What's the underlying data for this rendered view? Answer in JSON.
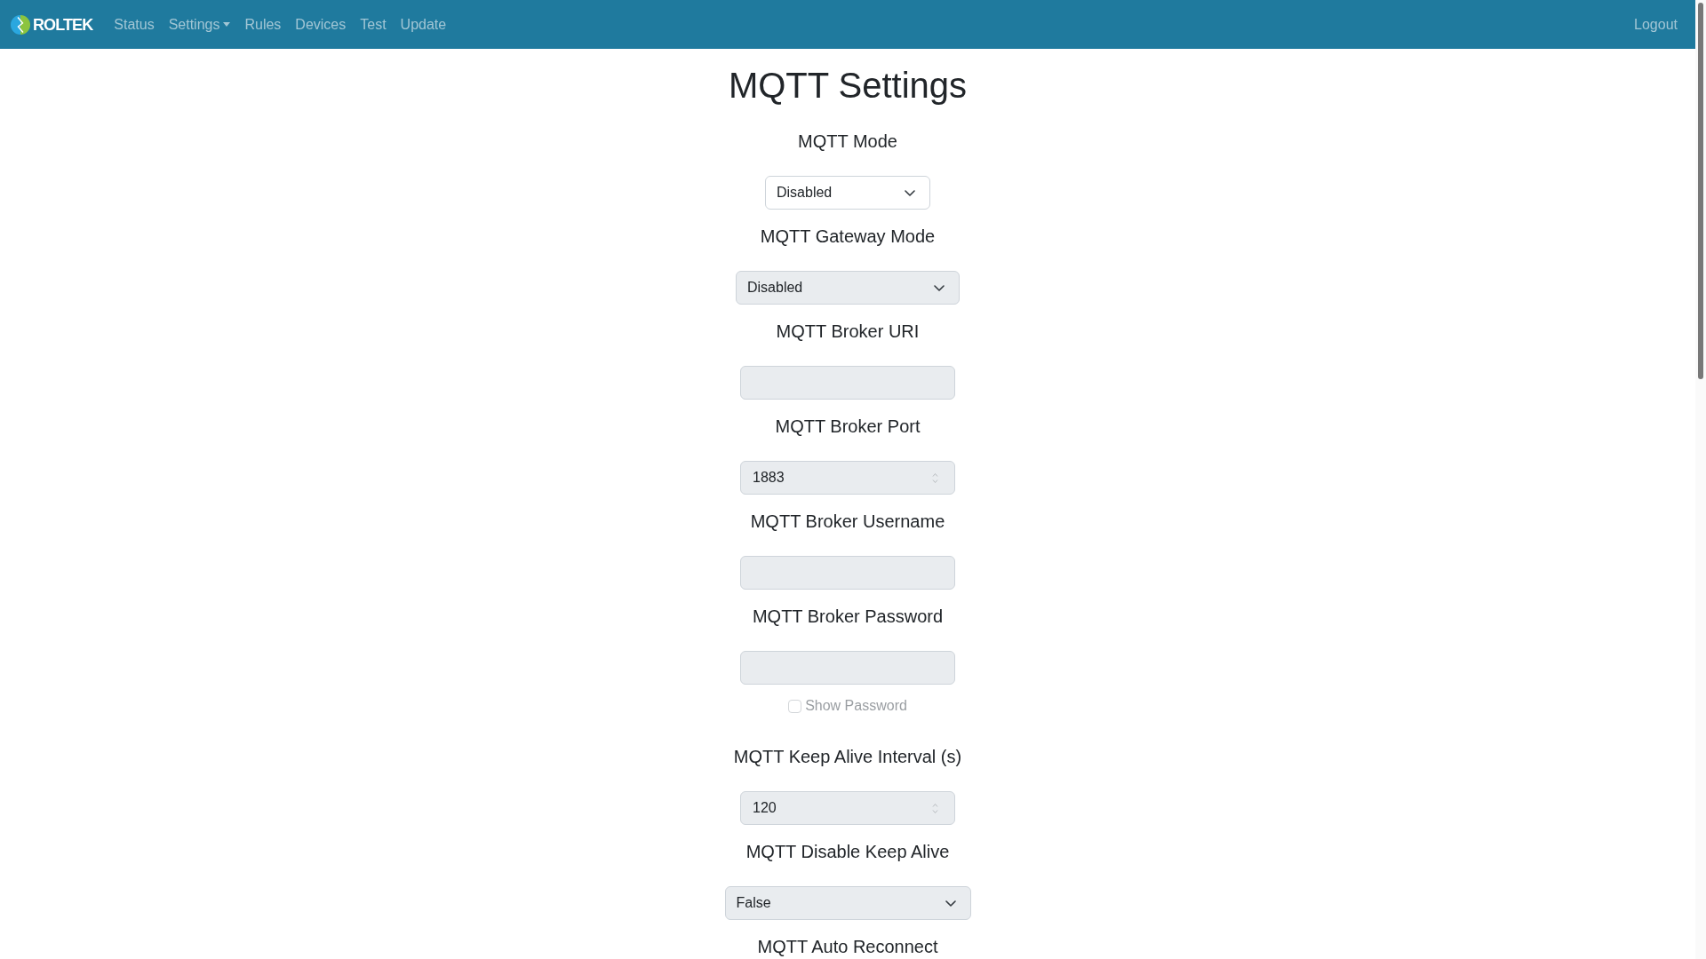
{
  "navbar": {
    "brand": "ROLTEK",
    "links": [
      {
        "label": "Status",
        "dropdown": false
      },
      {
        "label": "Settings",
        "dropdown": true
      },
      {
        "label": "Rules",
        "dropdown": false
      },
      {
        "label": "Devices",
        "dropdown": false
      },
      {
        "label": "Test",
        "dropdown": false
      },
      {
        "label": "Update",
        "dropdown": false
      }
    ],
    "logout": "Logout"
  },
  "page_title": "MQTT Settings",
  "fields": [
    {
      "label": "MQTT Mode",
      "kind": "select",
      "value": "Disabled",
      "disabled": false
    },
    {
      "label": "MQTT Gateway Mode",
      "kind": "select",
      "value": "Disabled",
      "disabled": true
    },
    {
      "label": "MQTT Broker URI",
      "kind": "text",
      "disabled": true
    },
    {
      "label": "MQTT Broker Port",
      "kind": "number",
      "value": "1883",
      "disabled": true
    },
    {
      "label": "MQTT Broker Username",
      "kind": "text",
      "disabled": true
    },
    {
      "label": "MQTT Broker Password",
      "kind": "password",
      "disabled": true,
      "show_password": {
        "label": "Show Password",
        "checked": false,
        "disabled": true
      }
    },
    {
      "label": "MQTT Keep Alive Interval (s)",
      "kind": "number",
      "value": "120",
      "disabled": true
    },
    {
      "label": "MQTT Disable Keep Alive",
      "kind": "select",
      "value": "False",
      "disabled": true
    },
    {
      "label": "MQTT Auto Reconnect"
    }
  ]
}
